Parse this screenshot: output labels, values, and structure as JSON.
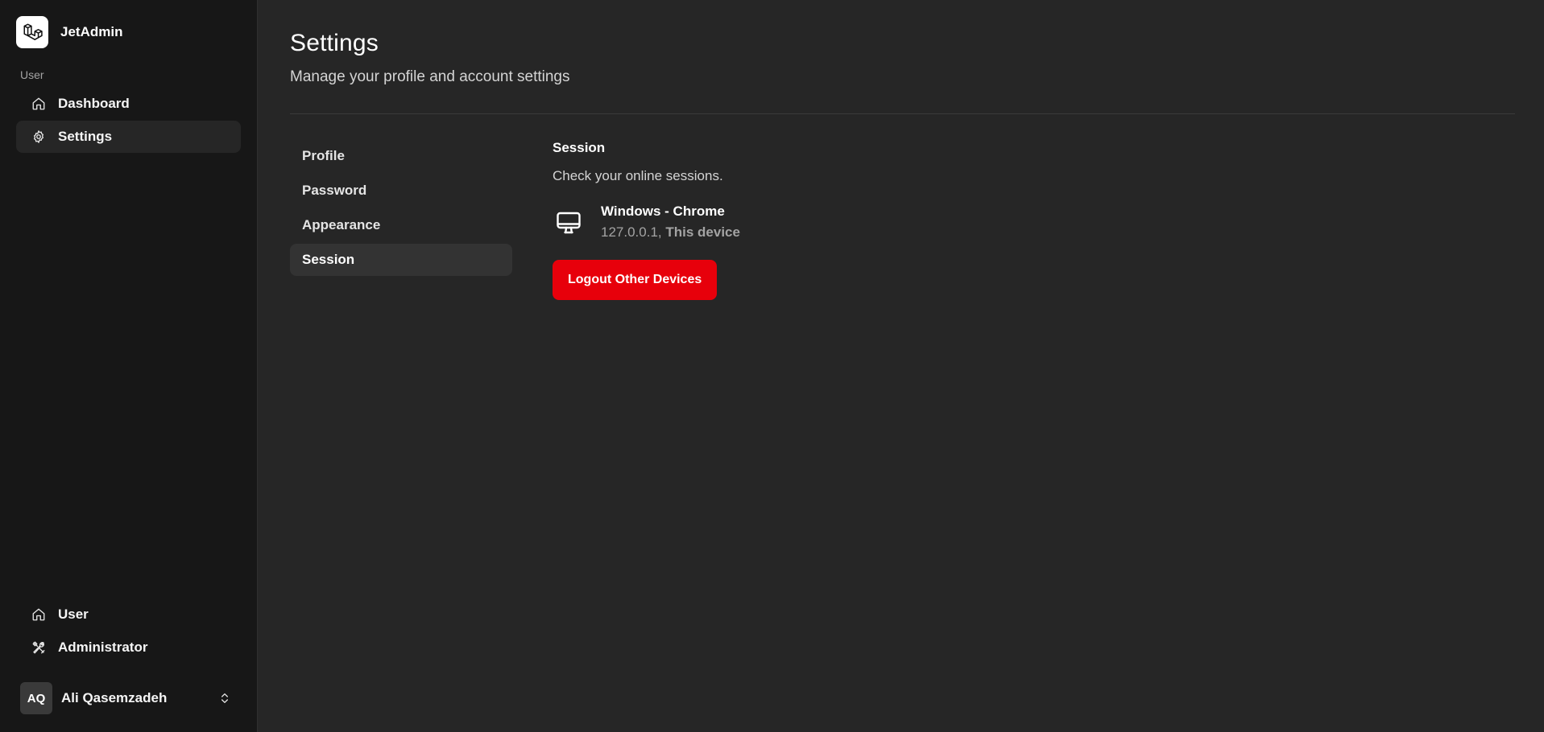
{
  "brand": {
    "name": "JetAdmin",
    "logo_icon": "laravel-logo-icon"
  },
  "sidebar": {
    "section_label": "User",
    "items": [
      {
        "label": "Dashboard",
        "icon": "home-icon",
        "active": false
      },
      {
        "label": "Settings",
        "icon": "gear-icon",
        "active": true
      }
    ],
    "bottom_items": [
      {
        "label": "User",
        "icon": "home-icon"
      },
      {
        "label": "Administrator",
        "icon": "tools-icon"
      }
    ],
    "user": {
      "initials": "AQ",
      "name": "Ali Qasemzadeh",
      "menu_icon": "chevrons-up-down-icon"
    }
  },
  "main": {
    "title": "Settings",
    "subtitle": "Manage your profile and account settings",
    "tabs": [
      {
        "label": "Profile",
        "active": false
      },
      {
        "label": "Password",
        "active": false
      },
      {
        "label": "Appearance",
        "active": false
      },
      {
        "label": "Session",
        "active": true
      }
    ],
    "session": {
      "title": "Session",
      "description": "Check your online sessions.",
      "device": {
        "icon": "monitor-icon",
        "name": "Windows - Chrome",
        "ip": "127.0.0.1,",
        "current_label": "This device"
      },
      "logout_label": "Logout Other Devices"
    }
  },
  "colors": {
    "sidebar_bg": "#171717",
    "main_bg": "#262626",
    "accent_danger": "#e7000b",
    "active_item_bg": "#333333"
  }
}
